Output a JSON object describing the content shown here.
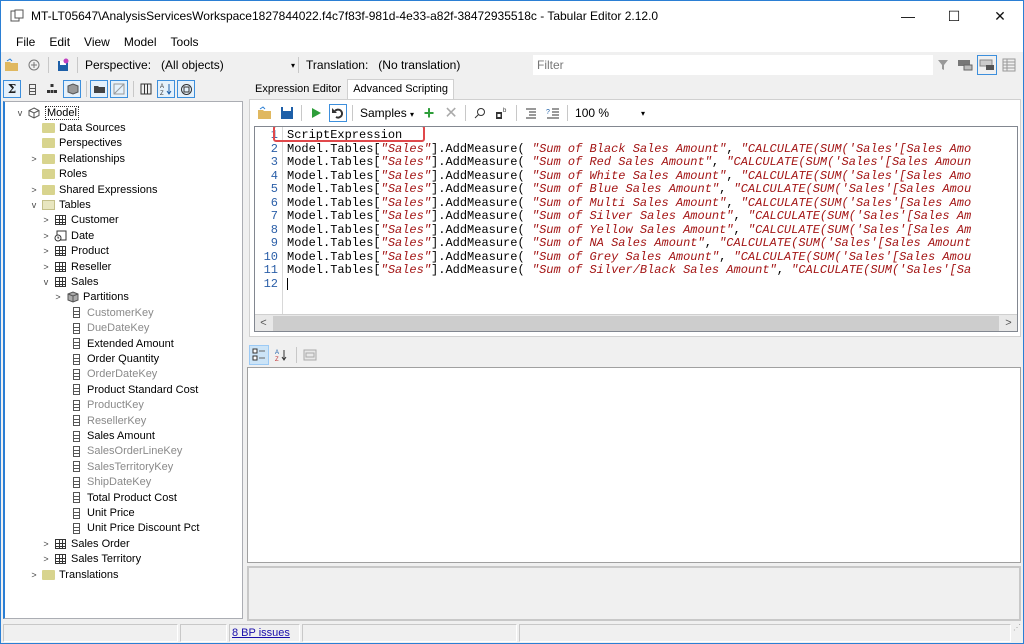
{
  "window": {
    "title": "MT-LT05647\\AnalysisServicesWorkspace1827844022.f4c7f83f-981d-4e33-a82f-38472935518c - Tabular Editor 2.12.0",
    "controls": {
      "minimize": "—",
      "maximize": "☐",
      "close": "✕"
    }
  },
  "menu": [
    "File",
    "Edit",
    "View",
    "Model",
    "Tools"
  ],
  "toolbar": {
    "perspective_label": "Perspective:",
    "perspective_value": "(All objects)",
    "translation_label": "Translation:",
    "translation_value": "(No translation)",
    "filter_placeholder": "Filter",
    "dropdown_arrow": "▾"
  },
  "tree": {
    "root": "Model",
    "items": [
      {
        "label": "Data Sources",
        "type": "folder",
        "expander": ""
      },
      {
        "label": "Perspectives",
        "type": "folder",
        "expander": ""
      },
      {
        "label": "Relationships",
        "type": "folder",
        "expander": ">"
      },
      {
        "label": "Roles",
        "type": "folder",
        "expander": ""
      },
      {
        "label": "Shared Expressions",
        "type": "folder",
        "expander": ">"
      },
      {
        "label": "Tables",
        "type": "folder-open",
        "expander": "v"
      },
      {
        "label": "Customer",
        "type": "table",
        "expander": ">"
      },
      {
        "label": "Date",
        "type": "date-table",
        "expander": ">"
      },
      {
        "label": "Product",
        "type": "table",
        "expander": ">"
      },
      {
        "label": "Reseller",
        "type": "table",
        "expander": ">"
      },
      {
        "label": "Sales",
        "type": "table",
        "expander": "v"
      },
      {
        "label": "Partitions",
        "type": "partitions",
        "expander": ">"
      },
      {
        "label": "CustomerKey",
        "type": "column",
        "hidden": true
      },
      {
        "label": "DueDateKey",
        "type": "column",
        "hidden": true
      },
      {
        "label": "Extended Amount",
        "type": "column",
        "hidden": false
      },
      {
        "label": "Order Quantity",
        "type": "column",
        "hidden": false
      },
      {
        "label": "OrderDateKey",
        "type": "column",
        "hidden": true
      },
      {
        "label": "Product Standard Cost",
        "type": "column",
        "hidden": false
      },
      {
        "label": "ProductKey",
        "type": "column",
        "hidden": true
      },
      {
        "label": "ResellerKey",
        "type": "column",
        "hidden": true
      },
      {
        "label": "Sales Amount",
        "type": "column",
        "hidden": false
      },
      {
        "label": "SalesOrderLineKey",
        "type": "column",
        "hidden": true
      },
      {
        "label": "SalesTerritoryKey",
        "type": "column",
        "hidden": true
      },
      {
        "label": "ShipDateKey",
        "type": "column",
        "hidden": true
      },
      {
        "label": "Total Product Cost",
        "type": "column",
        "hidden": false
      },
      {
        "label": "Unit Price",
        "type": "column",
        "hidden": false
      },
      {
        "label": "Unit Price Discount Pct",
        "type": "column",
        "hidden": false
      },
      {
        "label": "Sales Order",
        "type": "table",
        "expander": ">"
      },
      {
        "label": "Sales Territory",
        "type": "table",
        "expander": ">"
      },
      {
        "label": "Translations",
        "type": "folder",
        "expander": ">"
      }
    ]
  },
  "tabs": [
    {
      "label": "Expression Editor",
      "active": false
    },
    {
      "label": "Advanced Scripting",
      "active": true
    }
  ],
  "script_toolbar": {
    "samples_label": "Samples",
    "zoom_value": "100 %"
  },
  "editor": {
    "line_numbers": [
      "1",
      "2",
      "3",
      "4",
      "5",
      "6",
      "7",
      "8",
      "9",
      "10",
      "11",
      "12"
    ],
    "lines": [
      {
        "plain": "ScriptExpression"
      },
      {
        "prefix": "Model.Tables[",
        "table": "\"Sales\"",
        "mid": "].AddMeasure( ",
        "name": "\"Sum of Black Sales Amount\"",
        "sep": ", ",
        "expr": "\"CALCULATE(SUM('Sales'[Sales Amo"
      },
      {
        "prefix": "Model.Tables[",
        "table": "\"Sales\"",
        "mid": "].AddMeasure( ",
        "name": "\"Sum of Red Sales Amount\"",
        "sep": ", ",
        "expr": "\"CALCULATE(SUM('Sales'[Sales Amoun"
      },
      {
        "prefix": "Model.Tables[",
        "table": "\"Sales\"",
        "mid": "].AddMeasure( ",
        "name": "\"Sum of White Sales Amount\"",
        "sep": ", ",
        "expr": "\"CALCULATE(SUM('Sales'[Sales Amo"
      },
      {
        "prefix": "Model.Tables[",
        "table": "\"Sales\"",
        "mid": "].AddMeasure( ",
        "name": "\"Sum of Blue Sales Amount\"",
        "sep": ", ",
        "expr": "\"CALCULATE(SUM('Sales'[Sales Amou"
      },
      {
        "prefix": "Model.Tables[",
        "table": "\"Sales\"",
        "mid": "].AddMeasure( ",
        "name": "\"Sum of Multi Sales Amount\"",
        "sep": ", ",
        "expr": "\"CALCULATE(SUM('Sales'[Sales Amo"
      },
      {
        "prefix": "Model.Tables[",
        "table": "\"Sales\"",
        "mid": "].AddMeasure( ",
        "name": "\"Sum of Silver Sales Amount\"",
        "sep": ", ",
        "expr": "\"CALCULATE(SUM('Sales'[Sales Am"
      },
      {
        "prefix": "Model.Tables[",
        "table": "\"Sales\"",
        "mid": "].AddMeasure( ",
        "name": "\"Sum of Yellow Sales Amount\"",
        "sep": ", ",
        "expr": "\"CALCULATE(SUM('Sales'[Sales Am"
      },
      {
        "prefix": "Model.Tables[",
        "table": "\"Sales\"",
        "mid": "].AddMeasure( ",
        "name": "\"Sum of NA Sales Amount\"",
        "sep": ", ",
        "expr": "\"CALCULATE(SUM('Sales'[Sales Amount"
      },
      {
        "prefix": "Model.Tables[",
        "table": "\"Sales\"",
        "mid": "].AddMeasure( ",
        "name": "\"Sum of Grey Sales Amount\"",
        "sep": ", ",
        "expr": "\"CALCULATE(SUM('Sales'[Sales Amou"
      },
      {
        "prefix": "Model.Tables[",
        "table": "\"Sales\"",
        "mid": "].AddMeasure( ",
        "name": "\"Sum of Silver/Black Sales Amount\"",
        "sep": ", ",
        "expr": "\"CALCULATE(SUM('Sales'[Sa"
      },
      {
        "plain": ""
      }
    ],
    "scroll_left": "<",
    "scroll_right": ">"
  },
  "statusbar": {
    "bp_issues": "8 BP issues"
  },
  "colors": {
    "accent": "#2b7fd4",
    "string": "#a31515",
    "highlight_box": "#e0484b",
    "link": "#1a0dab"
  }
}
